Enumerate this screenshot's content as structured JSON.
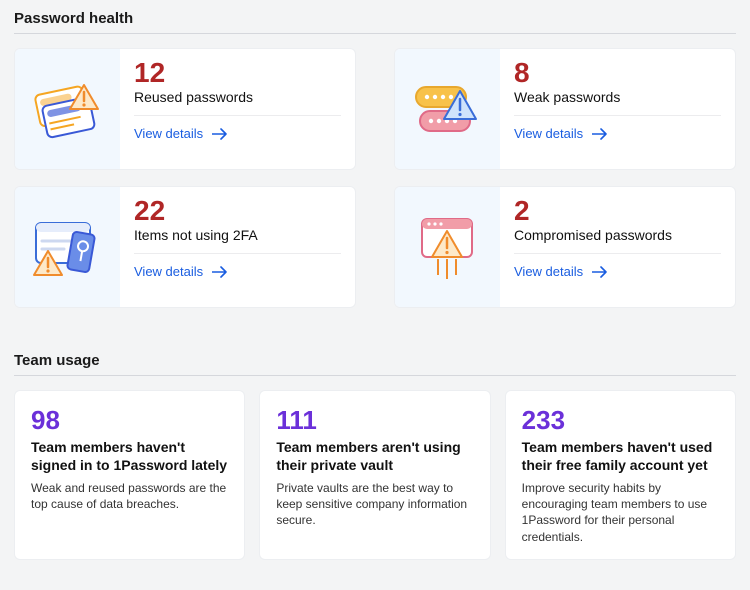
{
  "passwordHealth": {
    "title": "Password health",
    "cards": [
      {
        "count": "12",
        "label": "Reused passwords",
        "link": "View details"
      },
      {
        "count": "8",
        "label": "Weak passwords",
        "link": "View details"
      },
      {
        "count": "22",
        "label": "Items not using 2FA",
        "link": "View details"
      },
      {
        "count": "2",
        "label": "Compromised passwords",
        "link": "View details"
      }
    ]
  },
  "teamUsage": {
    "title": "Team usage",
    "cards": [
      {
        "count": "98",
        "label": "Team members haven't signed in to 1Password lately",
        "desc": "Weak and reused passwords are the top cause of data breaches."
      },
      {
        "count": "111",
        "label": "Team members aren't using their private vault",
        "desc": "Private vaults are the best way to keep sensitive company information secure."
      },
      {
        "count": "233",
        "label": "Team members haven't used their free family account yet",
        "desc": "Improve security habits by encouraging team members to use 1Password for their personal credentials."
      }
    ]
  }
}
